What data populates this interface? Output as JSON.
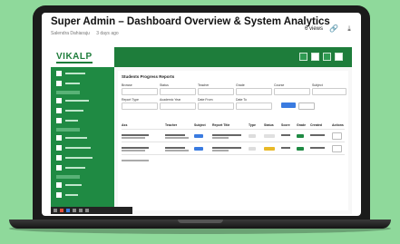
{
  "card": {
    "title": "Super Admin – Dashboard Overview & System Analytics",
    "author": "Salendra Dahiaraju",
    "posted": "3 days ago",
    "views": "6 views"
  },
  "app": {
    "logo": "VIKALP",
    "section_title": "Students Progress Reports",
    "filters": [
      "Browse",
      "Status",
      "Teacher",
      "Grade",
      "Course",
      "Subject"
    ],
    "filters2": [
      "Report Type",
      "Academic Year",
      "Date From",
      "Date To"
    ],
    "table_headers": [
      "Ass",
      "Teacher",
      "Subject",
      "Report Title",
      "Type",
      "Status",
      "Score",
      "Grade",
      "Created",
      "Actions"
    ],
    "status_colors": {
      "accent": "#1e7d3b",
      "blue": "#3a7be0",
      "yellow": "#e8b928"
    }
  },
  "icons": [
    "link-icon",
    "download-icon"
  ]
}
